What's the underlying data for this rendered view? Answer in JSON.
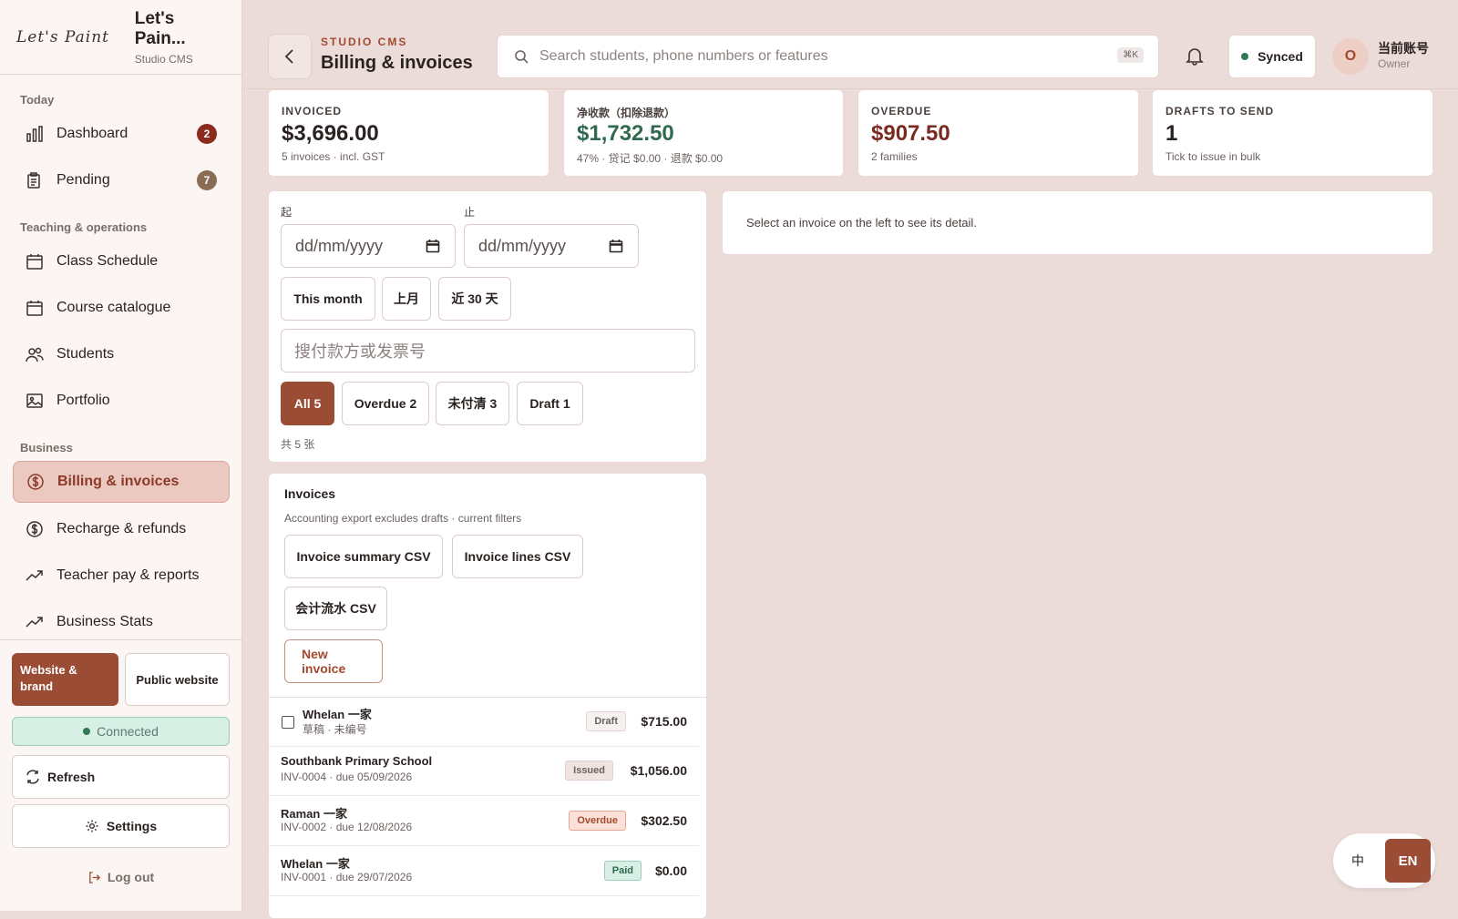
{
  "brand": {
    "script": "Let's Paint",
    "title": "Let's Pain...",
    "subtitle": "Studio CMS"
  },
  "sidebar": {
    "sections": [
      "Today",
      "Teaching & operations",
      "Business"
    ],
    "items": [
      {
        "label": "Dashboard",
        "icon": "bar-chart-icon",
        "badge": "2",
        "badge_color": "#8b2a1e"
      },
      {
        "label": "Pending",
        "icon": "clipboard-icon",
        "badge": "7",
        "badge_color": "#8a6c55"
      },
      {
        "label": "Class Schedule",
        "icon": "calendar-icon"
      },
      {
        "label": "Course catalogue",
        "icon": "calendar-icon"
      },
      {
        "label": "Students",
        "icon": "users-icon"
      },
      {
        "label": "Portfolio",
        "icon": "image-icon"
      },
      {
        "label": "Billing & invoices",
        "icon": "dollar-icon",
        "active": true
      },
      {
        "label": "Recharge & refunds",
        "icon": "dollar-icon"
      },
      {
        "label": "Teacher pay & reports",
        "icon": "trend-icon"
      },
      {
        "label": "Business Stats",
        "icon": "trend-icon"
      }
    ],
    "website_brand_label": "Website & brand",
    "public_website_label": "Public website",
    "connected_label": "Connected",
    "refresh_label": "Refresh",
    "settings_label": "Settings",
    "logout_label": "Log out"
  },
  "header": {
    "kicker": "STUDIO CMS",
    "title": "Billing & invoices",
    "search_placeholder": "Search students, phone numbers or features",
    "search_shortcut": "⌘K",
    "synced_label": "Synced",
    "avatar_initial": "O",
    "account_name": "当前账号",
    "account_role": "Owner"
  },
  "stats": [
    {
      "label": "INVOICED",
      "value": "$3,696.00",
      "sub": "5 invoices · incl. GST",
      "color": "#2a2220"
    },
    {
      "label": "净收款（扣除退款）",
      "value": "$1,732.50",
      "sub": "47% · 贷记 $0.00 · 退款 $0.00",
      "color": "#2f6a50"
    },
    {
      "label": "OVERDUE",
      "value": "$907.50",
      "sub": "2 families",
      "color": "#7a2b1f"
    },
    {
      "label": "DRAFTS TO SEND",
      "value": "1",
      "sub": "Tick to issue in bulk",
      "color": "#2a2220"
    }
  ],
  "filters": {
    "from_label": "起",
    "to_label": "止",
    "from_placeholder": "dd/mm/yyyy",
    "to_placeholder": "dd/mm/yyyy",
    "quick_ranges": [
      "This month",
      "上月",
      "近 30 天"
    ],
    "search_placeholder": "搜付款方或发票号",
    "status_chips": [
      "All 5",
      "Overdue 2",
      "未付清 3",
      "Draft 1"
    ],
    "count_text": "共 5 张"
  },
  "invoices": {
    "title": "Invoices",
    "note": "Accounting export excludes drafts · current filters",
    "export_buttons": [
      "Invoice summary CSV",
      "Invoice lines CSV",
      "会计流水 CSV"
    ],
    "new_invoice_label": "New invoice",
    "rows": [
      {
        "name": "Whelan 一家",
        "sub": "草稿 · 未编号",
        "status": "Draft",
        "status_class": "draft",
        "amount": "$715.00",
        "checkbox": true
      },
      {
        "name": "Southbank Primary School",
        "sub": "INV-0004 · due 05/09/2026",
        "status": "Issued",
        "status_class": "issued",
        "amount": "$1,056.00"
      },
      {
        "name": "Raman 一家",
        "sub": "INV-0002 · due 12/08/2026",
        "status": "Overdue",
        "status_class": "overdue",
        "amount": "$302.50"
      },
      {
        "name": "Whelan 一家",
        "sub": "INV-0001 · due 29/07/2026",
        "status": "Paid",
        "status_class": "paid",
        "amount": "$0.00"
      }
    ]
  },
  "detail": {
    "empty_text": "Select an invoice on the left to see its detail."
  },
  "language": {
    "zh": "中",
    "en": "EN"
  }
}
